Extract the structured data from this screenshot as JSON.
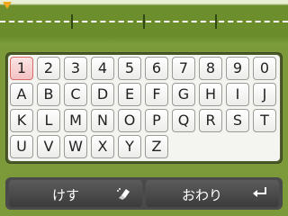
{
  "keyboard": {
    "rows": [
      [
        "1",
        "2",
        "3",
        "4",
        "5",
        "6",
        "7",
        "8",
        "9",
        "0"
      ],
      [
        "A",
        "B",
        "C",
        "D",
        "E",
        "F",
        "G",
        "H",
        "I",
        "J"
      ],
      [
        "K",
        "L",
        "M",
        "N",
        "O",
        "P",
        "Q",
        "R",
        "S",
        "T"
      ],
      [
        "U",
        "V",
        "W",
        "X",
        "Y",
        "Z"
      ]
    ],
    "selected_key": "1"
  },
  "buttons": {
    "erase_label": "けす",
    "erase_icon": "eraser-icon",
    "done_label": "おわり",
    "done_icon": "enter-arrow-icon"
  },
  "colors": {
    "top_band": "#6a8c2b",
    "panel_frame": "#4d5b2a",
    "key_selected": "#f3c2c2",
    "bottom_bar": "#4a4a4a"
  }
}
